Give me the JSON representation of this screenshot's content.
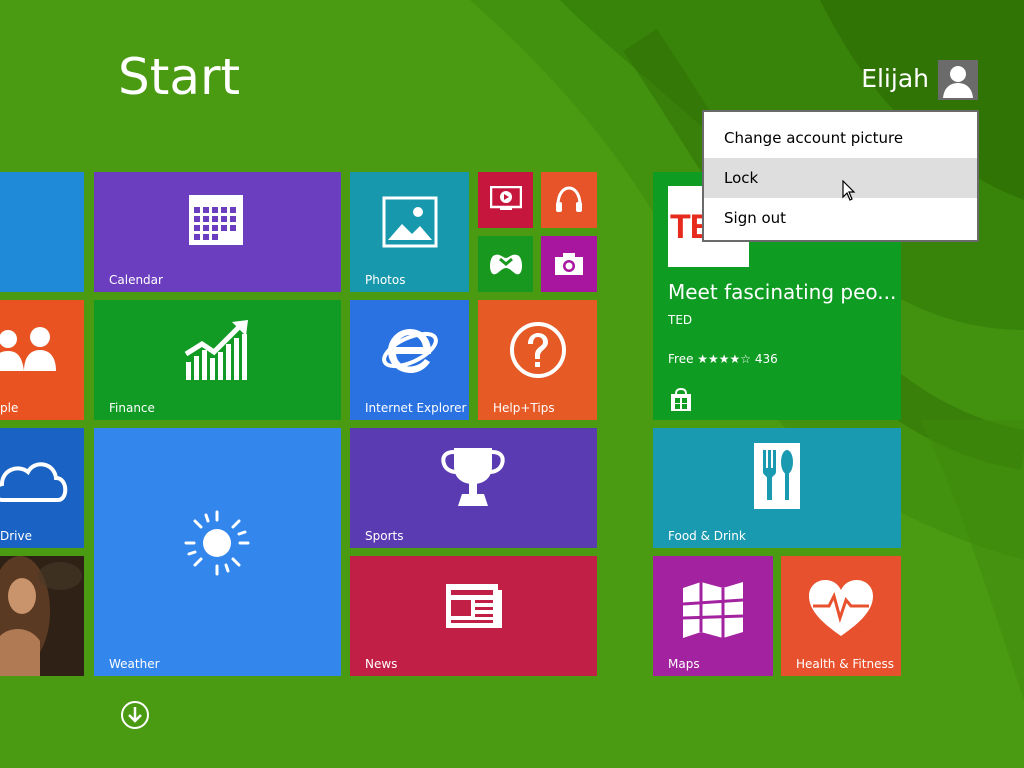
{
  "screen": {
    "title": "Start"
  },
  "user": {
    "name": "Elijah"
  },
  "account_menu": {
    "items": [
      {
        "label": "Change account picture"
      },
      {
        "label": "Lock"
      },
      {
        "label": "Sign out"
      }
    ]
  },
  "tiles": {
    "calendar": "Calendar",
    "photos": "Photos",
    "people": "ple",
    "finance": "Finance",
    "internet_explorer": "Internet Explorer",
    "help_tips": "Help+Tips",
    "onedrive": "Drive",
    "weather": "Weather",
    "sports": "Sports",
    "news": "News",
    "food_drink": "Food & Drink",
    "maps": "Maps",
    "health_fitness": "Health & Fitness"
  },
  "store_tile": {
    "badge_text": "TED",
    "headline": "Meet fascinating peo...",
    "publisher": "TED",
    "price_rating": "Free ★★★★☆ 436"
  },
  "colors": {
    "background": "#4a9a12",
    "calendar": "#6b3ec0",
    "photos": "#1798ac",
    "people": "#e85321",
    "finance": "#119b24",
    "ie": "#2a72e2",
    "help": "#e65a26",
    "onedrive": "#1a62c4",
    "weather": "#3386ec",
    "sports": "#5a3bb2",
    "news": "#c11f45",
    "store": "#0f9c23",
    "food": "#1a9ab1",
    "maps": "#a3229f",
    "health": "#e8512e",
    "video": "#c6163d",
    "music": "#e8542a",
    "games": "#18981f",
    "camera": "#a8159e"
  },
  "icons": [
    "calendar-icon",
    "photos-icon",
    "people-icon",
    "finance-chart-icon",
    "internet-explorer-icon",
    "help-question-icon",
    "cloud-icon",
    "sun-icon",
    "trophy-icon",
    "news-icon",
    "cutlery-icon",
    "map-icon",
    "heart-pulse-icon",
    "video-icon",
    "headphones-icon",
    "gamepad-icon",
    "camera-icon",
    "store-bag-icon",
    "user-silhouette-icon",
    "arrow-down-circle-icon",
    "mouse-cursor-icon"
  ]
}
